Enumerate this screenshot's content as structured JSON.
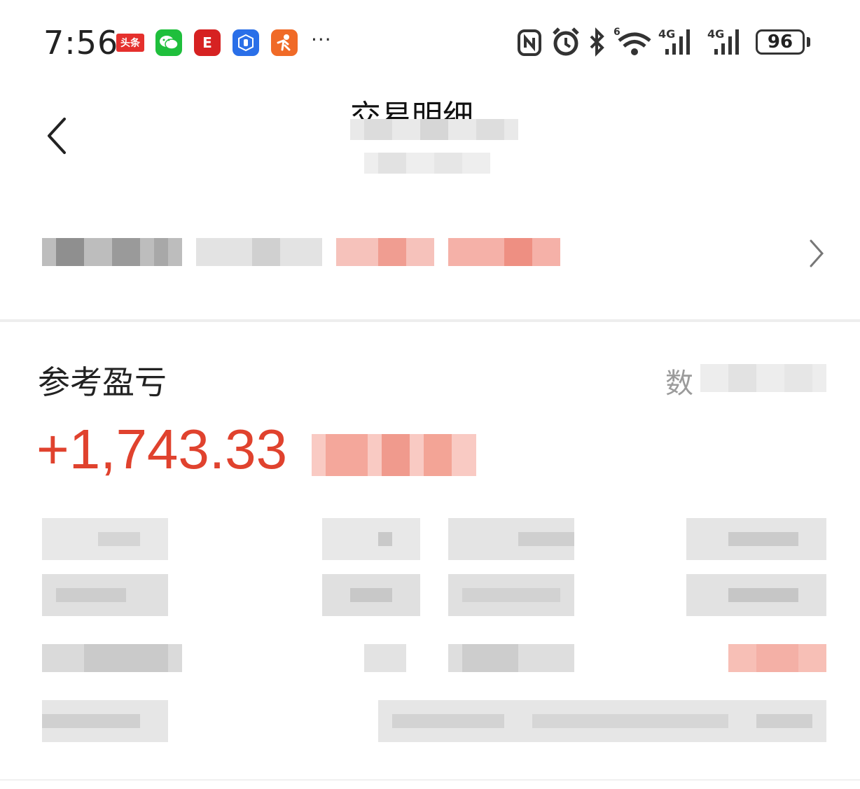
{
  "status_bar": {
    "time": "7:56",
    "apps": [
      {
        "name": "toutiao-icon",
        "label": "头条"
      },
      {
        "name": "wechat-icon",
        "label": ""
      },
      {
        "name": "red-app-icon",
        "label": "E"
      },
      {
        "name": "blue-app-icon",
        "label": ""
      },
      {
        "name": "orange-app-icon",
        "label": ""
      }
    ],
    "more": "···",
    "battery": "96"
  },
  "header": {
    "title": "交易明细"
  },
  "summary": {
    "section_title": "参考盈亏",
    "right_label_visible": "数",
    "profit": "+1,743.33"
  },
  "colors": {
    "profit_red": "#e0422e",
    "text_dark": "#222222",
    "text_gray": "#9b9b9b"
  }
}
